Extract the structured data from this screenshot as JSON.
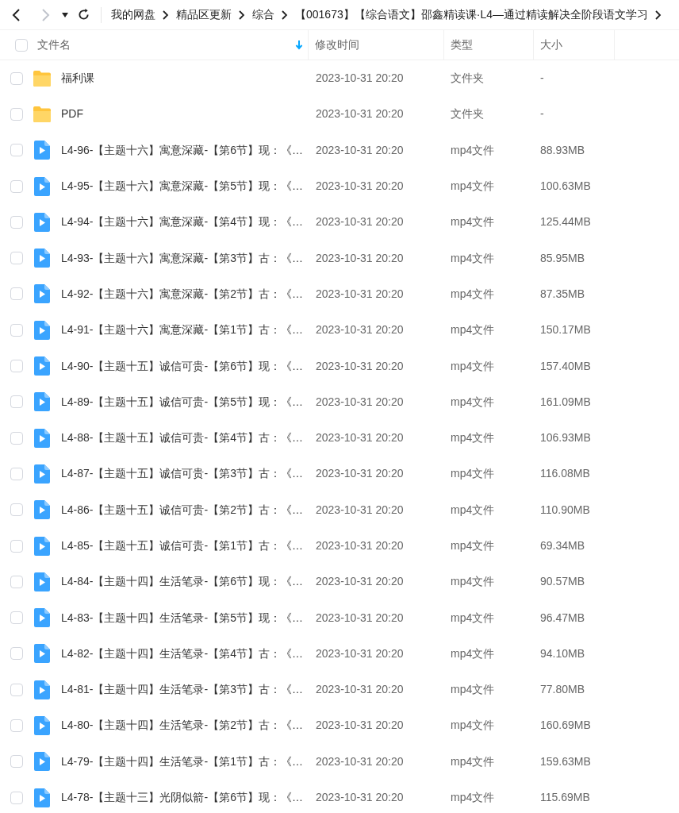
{
  "nav": {
    "back_disabled": false,
    "forward_disabled": true
  },
  "breadcrumb": [
    "我的网盘",
    "精品区更新",
    "综合",
    "【001673】【综合语文】邵鑫精读课·L4—通过精读解决全阶段语文学习"
  ],
  "columns": [
    {
      "label": "文件名",
      "sorted": true
    },
    {
      "label": "修改时间",
      "sorted": false
    },
    {
      "label": "类型",
      "sorted": false
    },
    {
      "label": "大小",
      "sorted": false
    }
  ],
  "header_checked": false,
  "rows": [
    {
      "kind": "folder",
      "name": "福利课",
      "modified": "2023-10-31 20:20",
      "type": "文件夹",
      "size": "-",
      "checked": false
    },
    {
      "kind": "folder",
      "name": "PDF",
      "modified": "2023-10-31 20:20",
      "type": "文件夹",
      "size": "-",
      "checked": false
    },
    {
      "kind": "video",
      "name": "L4-96-【主题十六】寓意深藏-【第6节】现：《…",
      "modified": "2023-10-31 20:20",
      "type": "mp4文件",
      "size": "88.93MB",
      "checked": false
    },
    {
      "kind": "video",
      "name": "L4-95-【主题十六】寓意深藏-【第5节】现：《…",
      "modified": "2023-10-31 20:20",
      "type": "mp4文件",
      "size": "100.63MB",
      "checked": false
    },
    {
      "kind": "video",
      "name": "L4-94-【主题十六】寓意深藏-【第4节】现：《…",
      "modified": "2023-10-31 20:20",
      "type": "mp4文件",
      "size": "125.44MB",
      "checked": false
    },
    {
      "kind": "video",
      "name": "L4-93-【主题十六】寓意深藏-【第3节】古：《…",
      "modified": "2023-10-31 20:20",
      "type": "mp4文件",
      "size": "85.95MB",
      "checked": false
    },
    {
      "kind": "video",
      "name": "L4-92-【主题十六】寓意深藏-【第2节】古：《…",
      "modified": "2023-10-31 20:20",
      "type": "mp4文件",
      "size": "87.35MB",
      "checked": false
    },
    {
      "kind": "video",
      "name": "L4-91-【主题十六】寓意深藏-【第1节】古：《…",
      "modified": "2023-10-31 20:20",
      "type": "mp4文件",
      "size": "150.17MB",
      "checked": false
    },
    {
      "kind": "video",
      "name": "L4-90-【主题十五】诚信可贵-【第6节】现：《…",
      "modified": "2023-10-31 20:20",
      "type": "mp4文件",
      "size": "157.40MB",
      "checked": false
    },
    {
      "kind": "video",
      "name": "L4-89-【主题十五】诚信可贵-【第5节】现：《…",
      "modified": "2023-10-31 20:20",
      "type": "mp4文件",
      "size": "161.09MB",
      "checked": false
    },
    {
      "kind": "video",
      "name": "L4-88-【主题十五】诚信可贵-【第4节】古：《…",
      "modified": "2023-10-31 20:20",
      "type": "mp4文件",
      "size": "106.93MB",
      "checked": false
    },
    {
      "kind": "video",
      "name": "L4-87-【主题十五】诚信可贵-【第3节】古：《…",
      "modified": "2023-10-31 20:20",
      "type": "mp4文件",
      "size": "116.08MB",
      "checked": false
    },
    {
      "kind": "video",
      "name": "L4-86-【主题十五】诚信可贵-【第2节】古：《…",
      "modified": "2023-10-31 20:20",
      "type": "mp4文件",
      "size": "110.90MB",
      "checked": false
    },
    {
      "kind": "video",
      "name": "L4-85-【主题十五】诚信可贵-【第1节】古：《…",
      "modified": "2023-10-31 20:20",
      "type": "mp4文件",
      "size": "69.34MB",
      "checked": false
    },
    {
      "kind": "video",
      "name": "L4-84-【主题十四】生活笔录-【第6节】现：《…",
      "modified": "2023-10-31 20:20",
      "type": "mp4文件",
      "size": "90.57MB",
      "checked": false
    },
    {
      "kind": "video",
      "name": "L4-83-【主题十四】生活笔录-【第5节】现：《…",
      "modified": "2023-10-31 20:20",
      "type": "mp4文件",
      "size": "96.47MB",
      "checked": false
    },
    {
      "kind": "video",
      "name": "L4-82-【主题十四】生活笔录-【第4节】古：《…",
      "modified": "2023-10-31 20:20",
      "type": "mp4文件",
      "size": "94.10MB",
      "checked": false
    },
    {
      "kind": "video",
      "name": "L4-81-【主题十四】生活笔录-【第3节】古：《…",
      "modified": "2023-10-31 20:20",
      "type": "mp4文件",
      "size": "77.80MB",
      "checked": false
    },
    {
      "kind": "video",
      "name": "L4-80-【主题十四】生活笔录-【第2节】古：《…",
      "modified": "2023-10-31 20:20",
      "type": "mp4文件",
      "size": "160.69MB",
      "checked": false
    },
    {
      "kind": "video",
      "name": "L4-79-【主题十四】生活笔录-【第1节】古：《…",
      "modified": "2023-10-31 20:20",
      "type": "mp4文件",
      "size": "159.63MB",
      "checked": false
    },
    {
      "kind": "video",
      "name": "L4-78-【主题十三】光阴似箭-【第6节】现：《…",
      "modified": "2023-10-31 20:20",
      "type": "mp4文件",
      "size": "115.69MB",
      "checked": false
    }
  ]
}
